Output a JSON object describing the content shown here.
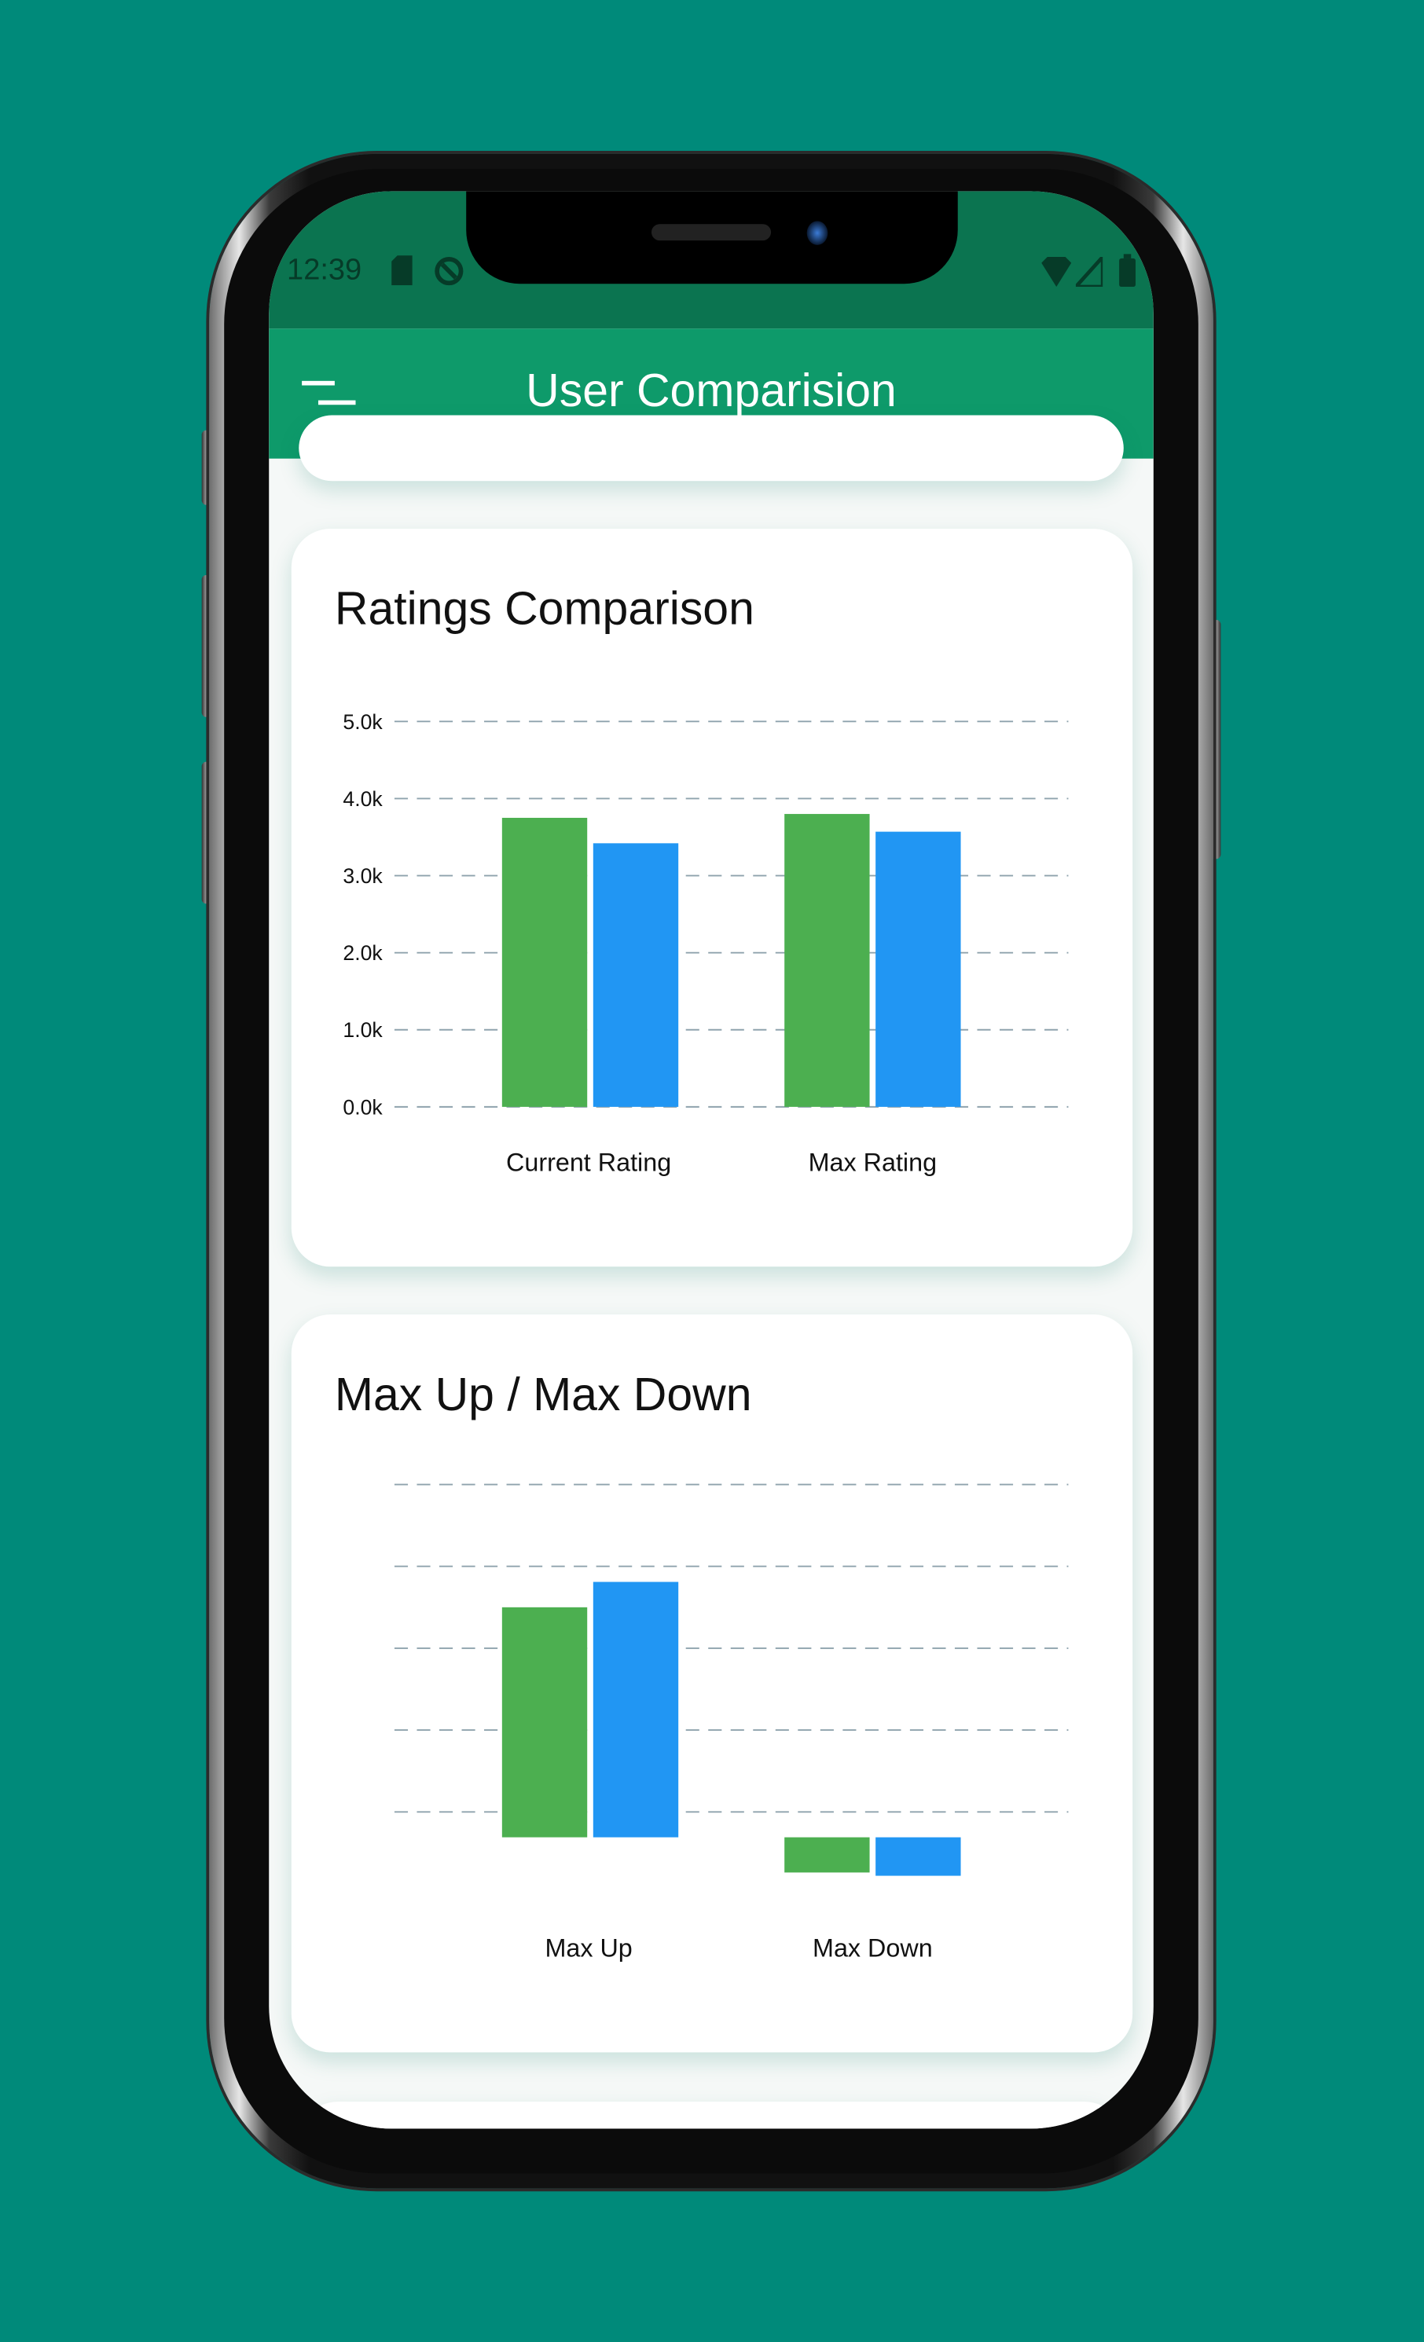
{
  "status_bar": {
    "time": "12:39",
    "icons": [
      "sd-card-icon",
      "sync-icon",
      "wifi-icon",
      "signal-icon",
      "battery-icon"
    ]
  },
  "app_bar": {
    "title": "User Comparision",
    "menu_icon": "menu-icon"
  },
  "colors": {
    "background": "#008a7a",
    "status_bar": "#0b7450",
    "app_bar": "#0e9a6a",
    "series_1": "#4caf50",
    "series_2": "#2196f3",
    "grid": "#8fa3ad"
  },
  "cards": [
    {
      "title": "Ratings Comparison"
    },
    {
      "title": "Max Up / Max Down"
    }
  ],
  "chart_data": [
    {
      "type": "bar",
      "title": "Ratings Comparison",
      "categories": [
        "Current Rating",
        "Max Rating"
      ],
      "series": [
        {
          "values": [
            3750,
            3800
          ],
          "color": "#4caf50"
        },
        {
          "values": [
            3420,
            3570
          ],
          "color": "#2196f3"
        }
      ],
      "ylim": [
        0,
        5000
      ],
      "yticks": [
        0,
        1000,
        2000,
        3000,
        4000,
        5000
      ],
      "ytick_labels": [
        "0.0k",
        "1.0k",
        "2.0k",
        "3.0k",
        "4.0k",
        "5.0k"
      ],
      "grid": true,
      "grid_style": "dashed"
    },
    {
      "type": "bar",
      "title": "Max Up / Max Down",
      "categories": [
        "Max Up",
        "Max Down"
      ],
      "series": [
        {
          "values": [
            2.81,
            -0.43
          ],
          "color": "#4caf50"
        },
        {
          "values": [
            3.12,
            -0.47
          ],
          "color": "#2196f3"
        }
      ],
      "gridlines": [
        0.31,
        1.31,
        2.31,
        3.31,
        4.31
      ],
      "ytick_labels": [],
      "grid": true,
      "grid_style": "dashed"
    }
  ]
}
